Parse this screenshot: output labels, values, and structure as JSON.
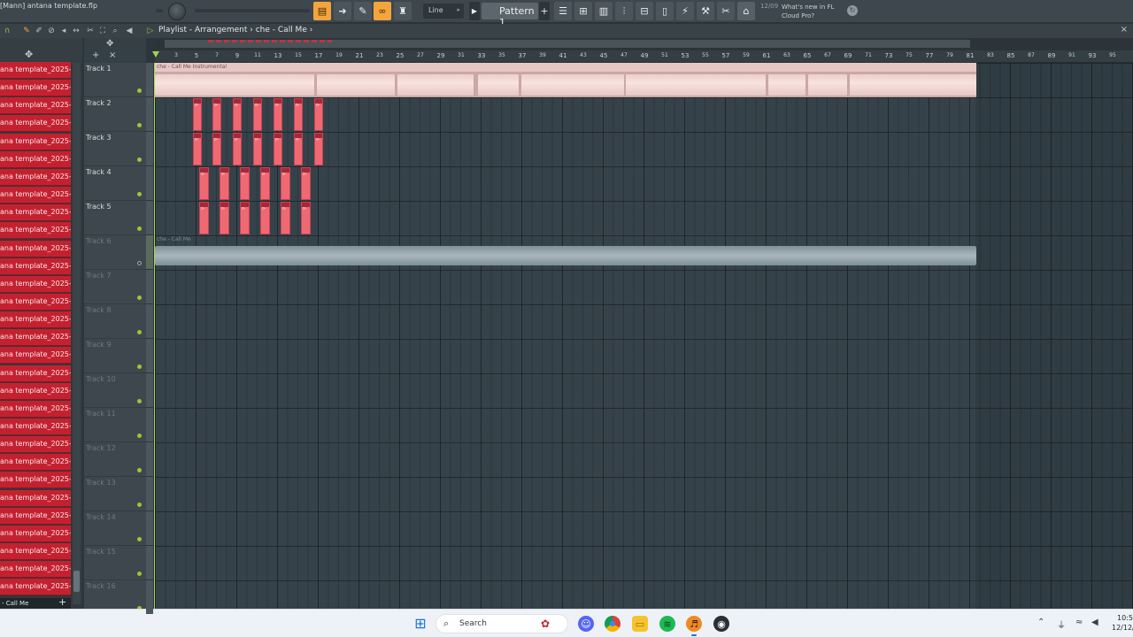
{
  "app": {
    "file_title": "[Mann] antana template.flp",
    "snap_mode": "Line",
    "pattern_label": "Pattern 1",
    "news_date": "12/09",
    "news_text": "What's new in FL Cloud Pro?",
    "accent": "#f3a53c",
    "snap_arrow": "▸"
  },
  "playlist": {
    "title": "Playlist - Arrangement",
    "separator": "›",
    "arrangement": "che - Call Me",
    "close_glyph": "×"
  },
  "channels": {
    "count": 30,
    "item_label": "ana template_2025-1...",
    "footer_label": "- Call Me",
    "add_glyph": "+",
    "color": "#c42130"
  },
  "tracks": [
    {
      "name": "Track 1",
      "state": "active"
    },
    {
      "name": "Track 2",
      "state": "active"
    },
    {
      "name": "Track 3",
      "state": "active"
    },
    {
      "name": "Track 4",
      "state": "active"
    },
    {
      "name": "Track 5",
      "state": "active"
    },
    {
      "name": "Track 6",
      "state": "muted"
    },
    {
      "name": "Track 7",
      "state": "empty"
    },
    {
      "name": "Track 8",
      "state": "empty"
    },
    {
      "name": "Track 9",
      "state": "empty"
    },
    {
      "name": "Track 10",
      "state": "empty"
    },
    {
      "name": "Track 11",
      "state": "empty"
    },
    {
      "name": "Track 12",
      "state": "empty"
    },
    {
      "name": "Track 13",
      "state": "empty"
    },
    {
      "name": "Track 14",
      "state": "empty"
    },
    {
      "name": "Track 15",
      "state": "empty"
    },
    {
      "name": "Track 16",
      "state": "empty"
    }
  ],
  "ruler": {
    "numbers": [
      "3",
      "5",
      "7",
      "9",
      "11",
      "13",
      "15",
      "17",
      "19",
      "21",
      "23",
      "25",
      "27",
      "29",
      "31",
      "33",
      "35",
      "37",
      "39",
      "41",
      "43",
      "45",
      "47",
      "49",
      "51",
      "53",
      "55",
      "57",
      "59",
      "61",
      "63",
      "65",
      "67",
      "69",
      "71",
      "73",
      "75",
      "77",
      "79",
      "81",
      "83",
      "85",
      "87",
      "89",
      "91",
      "93",
      "95"
    ]
  },
  "clips": {
    "instrumental_title": "che - Call Me Instrumental",
    "vocal_title": "che - Call Me",
    "pattern_glyph": "⊳"
  },
  "taskbar": {
    "search_label": "Search",
    "time": "10:5",
    "date": "12/12/"
  }
}
